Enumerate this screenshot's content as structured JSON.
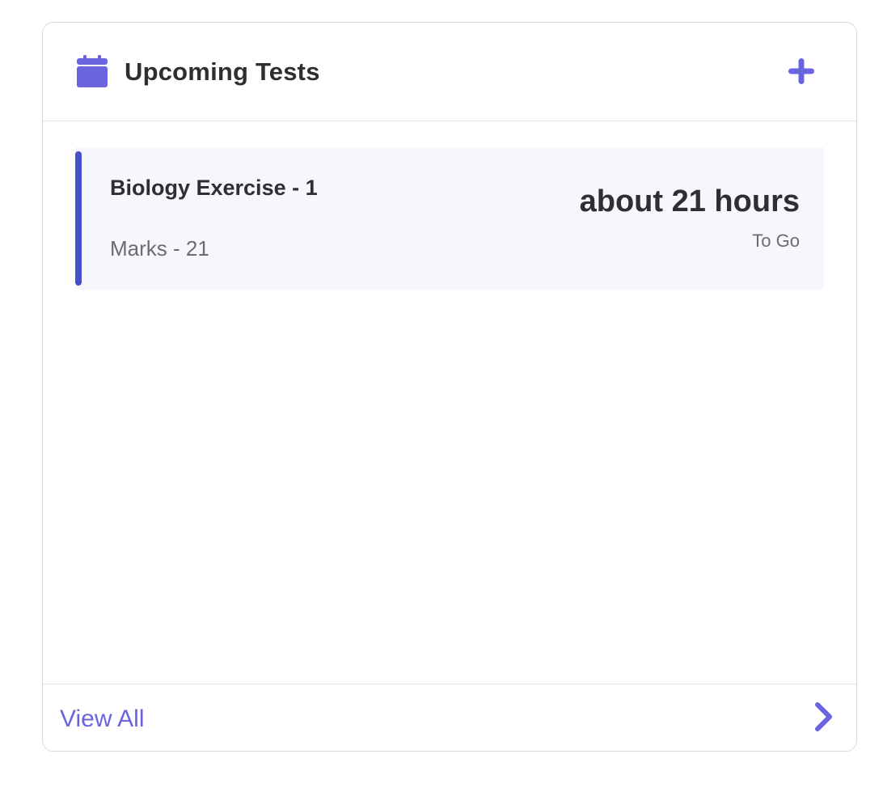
{
  "widget": {
    "title": "Upcoming Tests",
    "header_icon": "calendar-icon",
    "add_icon": "plus-icon",
    "accent_color": "#6a64de",
    "item_accent_color": "#4650c8"
  },
  "tests": [
    {
      "name": "Biology Exercise - 1",
      "marks": "Marks - 21",
      "time_remaining": "about 21 hours",
      "time_suffix": "To Go"
    }
  ],
  "footer": {
    "view_all_label": "View All",
    "chevron_icon": "chevron-right-icon"
  }
}
